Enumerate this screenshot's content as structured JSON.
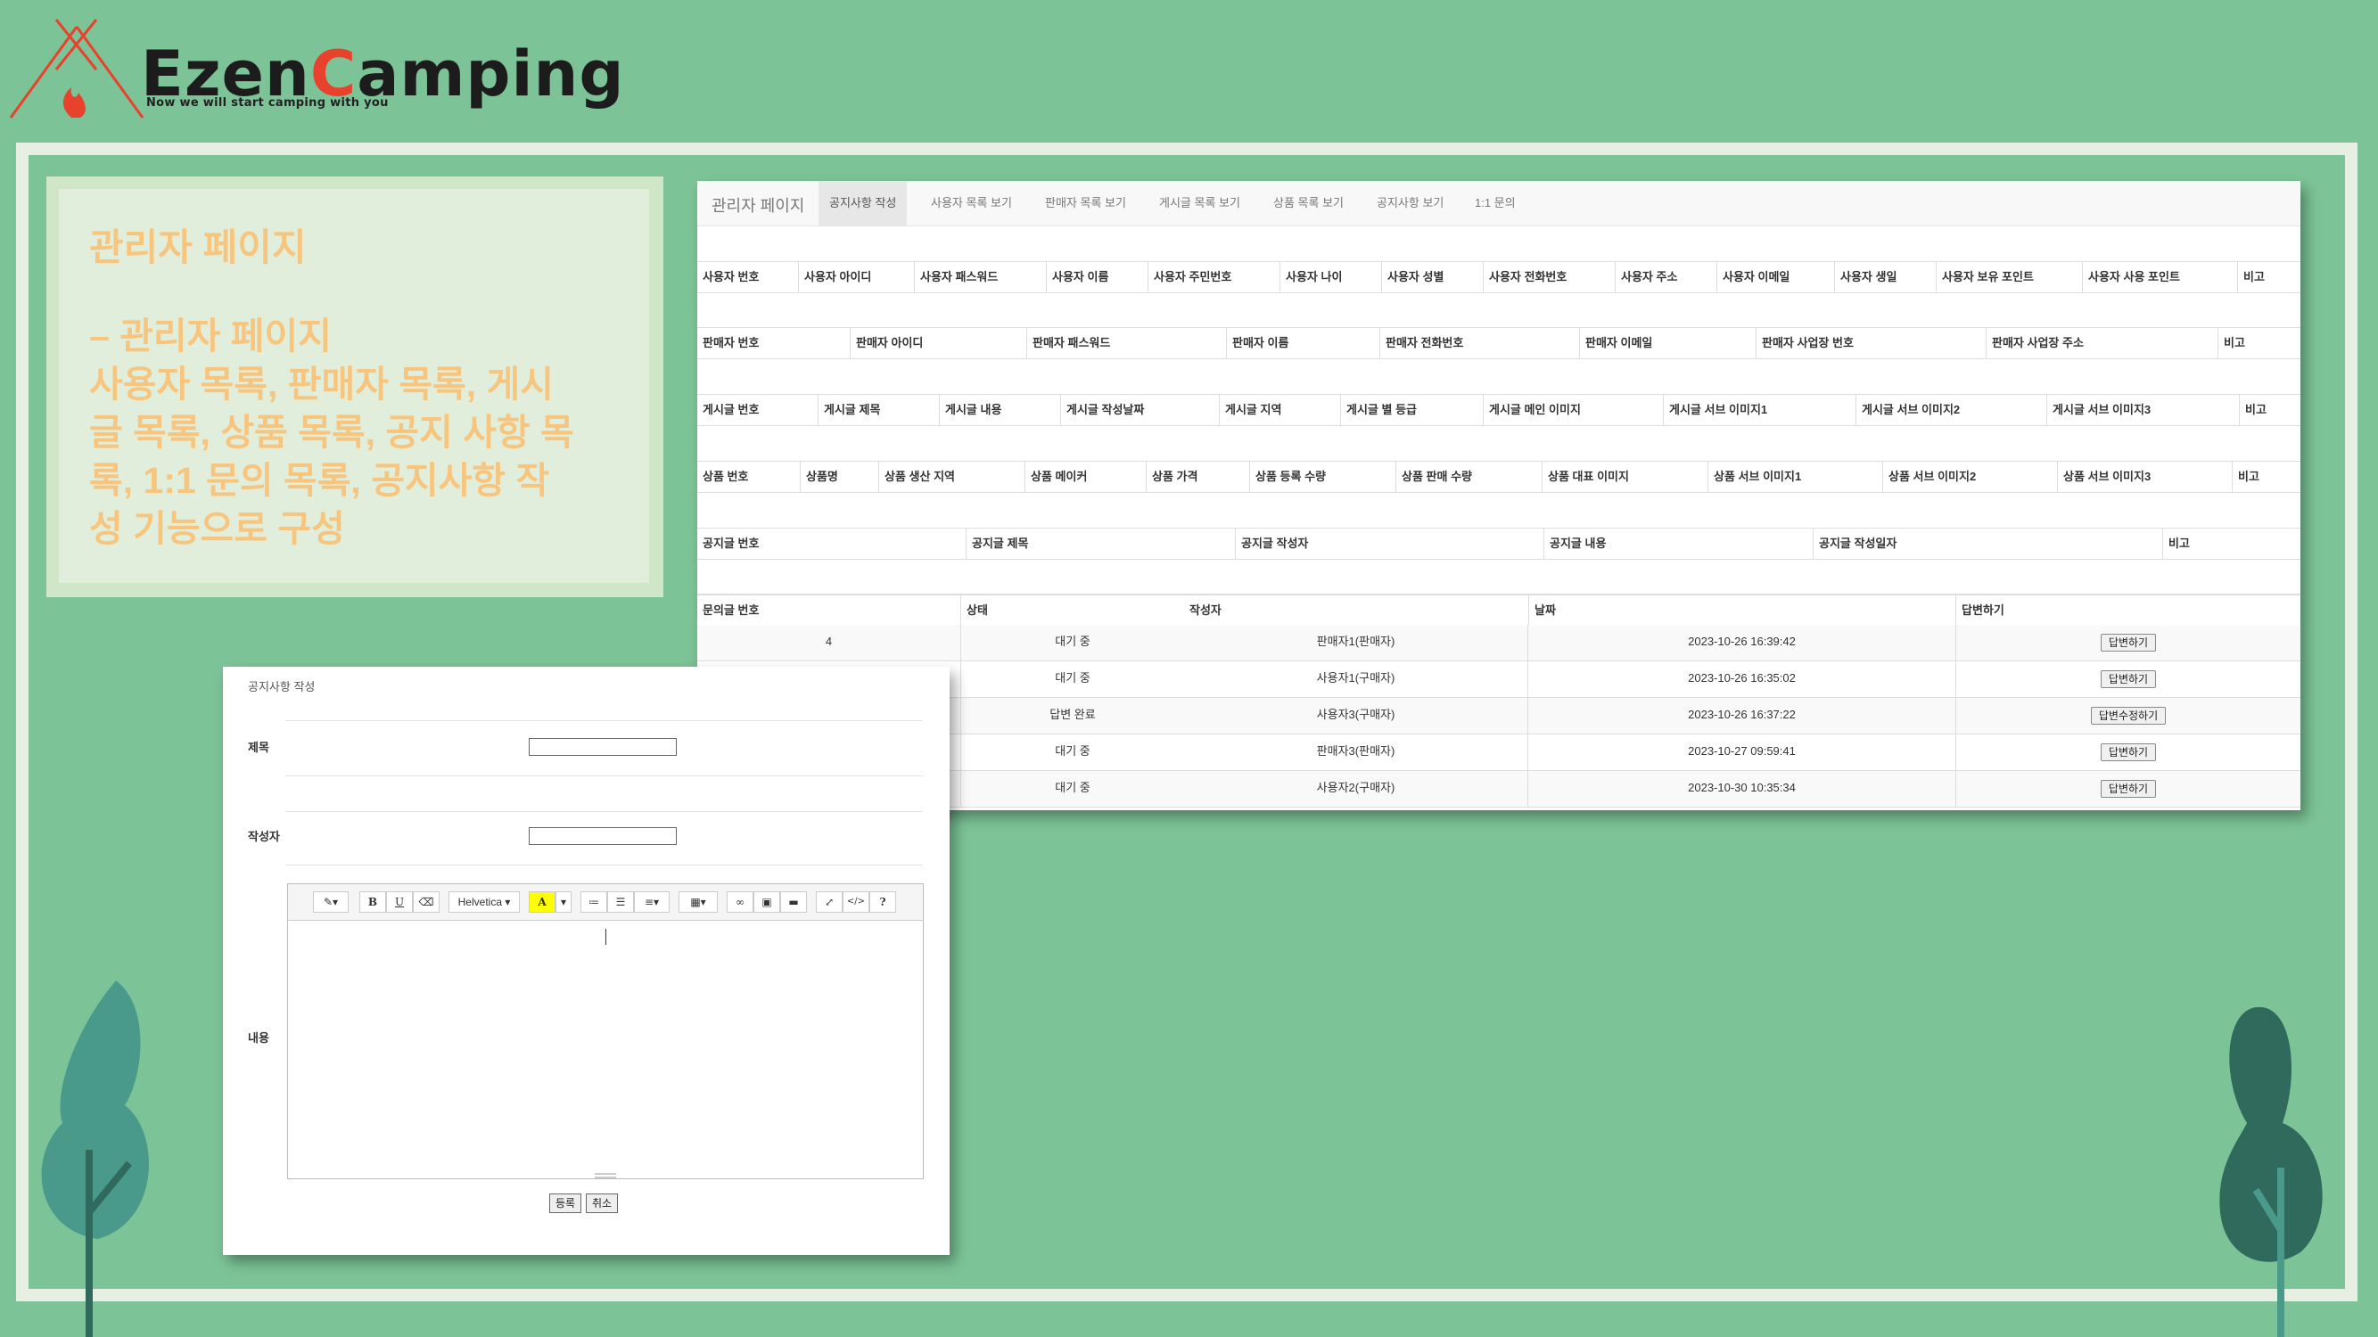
{
  "logo": {
    "name_left": "Ezen",
    "name_accent": "C",
    "name_right": "amping",
    "tagline": "Now we will start camping with you"
  },
  "info": {
    "title": "관리자 페이지",
    "body_lines": [
      "– 관리자 페이지",
      "사용자 목록, 판매자 목록, 게시",
      "글 목록, 상품 목록, 공지 사항 목",
      "록, 1:1 문의 목록, 공지사항 작",
      "성 기능으로 구성"
    ]
  },
  "admin": {
    "brand": "관리자 페이지",
    "tabs": [
      "공지사항 작성",
      "사용자 목록 보기",
      "판매자 목록 보기",
      "게시글 목록 보기",
      "상품 목록 보기",
      "공지사항 보기",
      "1:1 문의"
    ],
    "user_headers": [
      "사용자 번호",
      "사용자 아이디",
      "사용자 패스워드",
      "사용자 이름",
      "사용자 주민번호",
      "사용자 나이",
      "사용자 성별",
      "사용자 전화번호",
      "사용자 주소",
      "사용자 이메일",
      "사용자 생일",
      "사용자 보유 포인트",
      "사용자 사용 포인트",
      "비고"
    ],
    "seller_headers": [
      "판매자 번호",
      "판매자 아이디",
      "판매자 패스워드",
      "판매자 이름",
      "판매자 전화번호",
      "판매자 이메일",
      "판매자 사업장 번호",
      "판매자 사업장 주소",
      "비고"
    ],
    "post_headers": [
      "게시글 번호",
      "게시글 제목",
      "게시글 내용",
      "게시글 작성날짜",
      "게시글 지역",
      "게시글 별 등급",
      "게시글 메인 이미지",
      "게시글 서브 이미지1",
      "게시글 서브 이미지2",
      "게시글 서브 이미지3",
      "비고"
    ],
    "product_headers": [
      "상품 번호",
      "상품명",
      "상품 생산 지역",
      "상품 메이커",
      "상품 가격",
      "상품 등록 수량",
      "상품 판매 수량",
      "상품 대표 이미지",
      "상품 서브 이미지1",
      "상품 서브 이미지2",
      "상품 서브 이미지3",
      "비고"
    ],
    "notice_headers": [
      "공지글 번호",
      "공지글 제목",
      "공지글 작성자",
      "공지글 내용",
      "공지글 작성일자",
      "비고"
    ],
    "inquiry_headers": [
      "문의글 번호",
      "상태",
      "작성자",
      "날짜",
      "답변하기"
    ],
    "inquiries": [
      {
        "no": "4",
        "status": "대기 중",
        "author": "판매자1(판매자)",
        "date": "2023-10-26 16:39:42",
        "action": "답변하기"
      },
      {
        "no": "",
        "status": "대기 중",
        "author": "사용자1(구매자)",
        "date": "2023-10-26 16:35:02",
        "action": "답변하기"
      },
      {
        "no": "",
        "status": "답변 완료",
        "author": "사용자3(구매자)",
        "date": "2023-10-26 16:37:22",
        "action": "답변수정하기"
      },
      {
        "no": "",
        "status": "대기 중",
        "author": "판매자3(판매자)",
        "date": "2023-10-27 09:59:41",
        "action": "답변하기"
      },
      {
        "no": "",
        "status": "대기 중",
        "author": "사용자2(구매자)",
        "date": "2023-10-30 10:35:34",
        "action": "답변하기"
      }
    ]
  },
  "form": {
    "heading": "공지사항 작성",
    "title_label": "제목",
    "title_value": "",
    "author_label": "작성자",
    "author_value": "",
    "content_label": "내용",
    "font_name": "Helvetica",
    "submit_label": "등록",
    "cancel_label": "취소"
  },
  "colors": {
    "background": "#7cc497",
    "frame": "#e6efe1",
    "accent_text": "#f7c57e",
    "logo_red": "#e8412c",
    "tree_light": "#4a9a8b",
    "tree_dark": "#2f6a5d"
  }
}
